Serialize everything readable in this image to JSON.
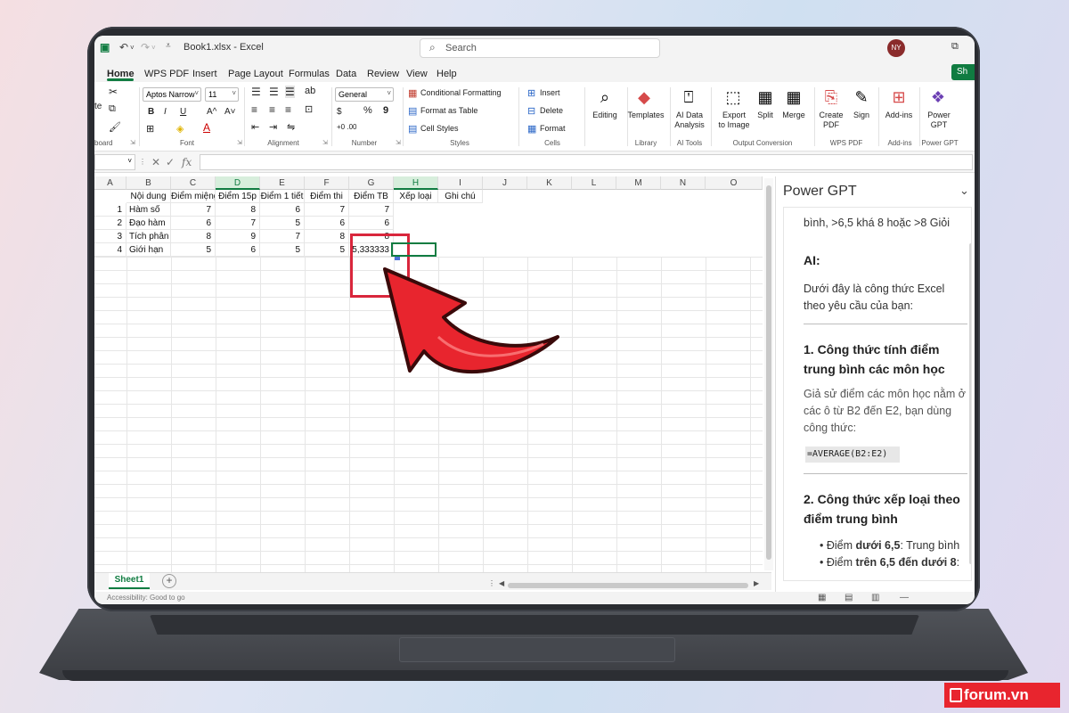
{
  "titlebar": {
    "file_title": "Book1.xlsx  -  Excel",
    "search_placeholder": "Search",
    "avatar_initials": "NY"
  },
  "menu": {
    "tabs": [
      "Home",
      "WPS PDF",
      "Insert",
      "Page Layout",
      "Formulas",
      "Data",
      "Review",
      "View",
      "Help"
    ],
    "active": "Home",
    "share_label": "Sh"
  },
  "ribbon": {
    "font_name": "Aptos Narrow",
    "font_size": "11",
    "number_format": "General",
    "paste_partial": "te",
    "clipboard_partial": "board",
    "bold": "B",
    "italic": "I",
    "underline": "U",
    "grow_font": "A^",
    "shrink_font": "A˅",
    "currency": "$",
    "percent": "%",
    "comma": "9",
    "dec_inc": "+0 .00",
    "cond_format": "Conditional Formatting",
    "format_table": "Format as Table",
    "cell_styles": "Cell Styles",
    "insert": "Insert",
    "delete": "Delete",
    "format": "Format",
    "editing": "Editing",
    "templates": "Templates",
    "ai_data_analysis": "AI Data\nAnalysis",
    "export_to_image": "Export\nto Image",
    "split": "Split",
    "merge": "Merge",
    "create_pdf": "Create\nPDF",
    "sign": "Sign",
    "add_ins": "Add-ins",
    "power_gpt": "Power\nGPT",
    "groups": {
      "font": "Font",
      "alignment": "Alignment",
      "number": "Number",
      "styles": "Styles",
      "cells": "Cells",
      "library": "Library",
      "ai_tools": "AI Tools",
      "output_conversion": "Output Conversion",
      "wps_pdf": "WPS PDF",
      "add_ins": "Add-ins",
      "power_gpt": "Power GPT"
    }
  },
  "formula_bar": {
    "fx": "fx",
    "cancel": "✕",
    "confirm": "✓"
  },
  "sheet": {
    "columns": [
      "A",
      "B",
      "C",
      "D",
      "E",
      "F",
      "G",
      "H",
      "I",
      "J",
      "K",
      "L",
      "M",
      "N",
      "O"
    ],
    "headers": [
      "Nội dung",
      "Điểm miệng",
      "Điểm 15p",
      "Điểm 1 tiết",
      "Điểm thi",
      "Điểm TB",
      "Xếp loại",
      "Ghi chú"
    ],
    "rows": [
      {
        "num": "1",
        "name": "Hàm số",
        "c": "7",
        "d": "8",
        "e": "6",
        "f": "7",
        "g": "7"
      },
      {
        "num": "2",
        "name": "Đạo hàm",
        "c": "6",
        "d": "7",
        "e": "5",
        "f": "6",
        "g": "6"
      },
      {
        "num": "3",
        "name": "Tích phân",
        "c": "8",
        "d": "9",
        "e": "7",
        "f": "8",
        "g": "8"
      },
      {
        "num": "4",
        "name": "Giới hạn",
        "c": "5",
        "d": "6",
        "e": "5",
        "f": "5",
        "g": "5,333333"
      }
    ],
    "sheet_tab": "Sheet1",
    "add_sheet": "+",
    "status": "Accessibility: Good to go"
  },
  "panel": {
    "title": "Power GPT",
    "line1": "bình, >6,5 khá 8 hoặc >8 Giỏi",
    "ai_label": "AI:",
    "intro": "Dưới đây là công thức Excel theo yêu cầu của bạn:",
    "h1": "1. Công thức tính điểm trung bình các môn học",
    "p1": "Giả sử điểm các môn học nằm ở các ô từ B2 đến E2, bạn dùng công thức:",
    "code": "=AVERAGE(B2:E2)",
    "h2": "2. Công thức xếp loại theo điểm trung bình",
    "bullet1_pre": "Điểm ",
    "bullet1_bold": "dưới 6,5",
    "bullet1_post": ": Trung bình",
    "bullet2_pre": "Điểm ",
    "bullet2_bold": "trên 6,5 đến dưới 8",
    "bullet2_post": ":"
  },
  "watermark": {
    "text": "forum.vn"
  },
  "colors": {
    "excel_green": "#107c41",
    "highlight_red": "#d9263c",
    "arrow_red": "#e8252e",
    "bezel": "#2a2c31"
  }
}
